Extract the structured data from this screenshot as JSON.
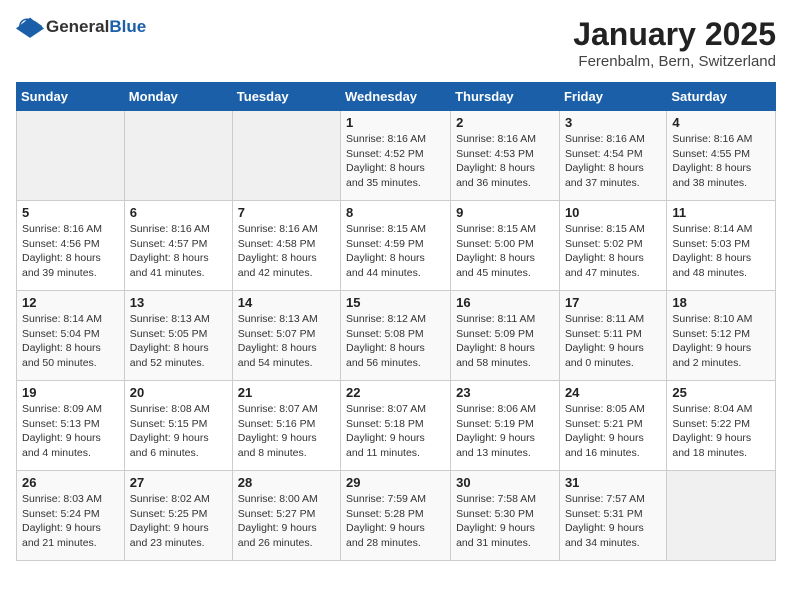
{
  "header": {
    "logo_general": "General",
    "logo_blue": "Blue",
    "title": "January 2025",
    "location": "Ferenbalm, Bern, Switzerland"
  },
  "weekdays": [
    "Sunday",
    "Monday",
    "Tuesday",
    "Wednesday",
    "Thursday",
    "Friday",
    "Saturday"
  ],
  "weeks": [
    [
      {
        "day": "",
        "content": ""
      },
      {
        "day": "",
        "content": ""
      },
      {
        "day": "",
        "content": ""
      },
      {
        "day": "1",
        "content": "Sunrise: 8:16 AM\nSunset: 4:52 PM\nDaylight: 8 hours\nand 35 minutes."
      },
      {
        "day": "2",
        "content": "Sunrise: 8:16 AM\nSunset: 4:53 PM\nDaylight: 8 hours\nand 36 minutes."
      },
      {
        "day": "3",
        "content": "Sunrise: 8:16 AM\nSunset: 4:54 PM\nDaylight: 8 hours\nand 37 minutes."
      },
      {
        "day": "4",
        "content": "Sunrise: 8:16 AM\nSunset: 4:55 PM\nDaylight: 8 hours\nand 38 minutes."
      }
    ],
    [
      {
        "day": "5",
        "content": "Sunrise: 8:16 AM\nSunset: 4:56 PM\nDaylight: 8 hours\nand 39 minutes."
      },
      {
        "day": "6",
        "content": "Sunrise: 8:16 AM\nSunset: 4:57 PM\nDaylight: 8 hours\nand 41 minutes."
      },
      {
        "day": "7",
        "content": "Sunrise: 8:16 AM\nSunset: 4:58 PM\nDaylight: 8 hours\nand 42 minutes."
      },
      {
        "day": "8",
        "content": "Sunrise: 8:15 AM\nSunset: 4:59 PM\nDaylight: 8 hours\nand 44 minutes."
      },
      {
        "day": "9",
        "content": "Sunrise: 8:15 AM\nSunset: 5:00 PM\nDaylight: 8 hours\nand 45 minutes."
      },
      {
        "day": "10",
        "content": "Sunrise: 8:15 AM\nSunset: 5:02 PM\nDaylight: 8 hours\nand 47 minutes."
      },
      {
        "day": "11",
        "content": "Sunrise: 8:14 AM\nSunset: 5:03 PM\nDaylight: 8 hours\nand 48 minutes."
      }
    ],
    [
      {
        "day": "12",
        "content": "Sunrise: 8:14 AM\nSunset: 5:04 PM\nDaylight: 8 hours\nand 50 minutes."
      },
      {
        "day": "13",
        "content": "Sunrise: 8:13 AM\nSunset: 5:05 PM\nDaylight: 8 hours\nand 52 minutes."
      },
      {
        "day": "14",
        "content": "Sunrise: 8:13 AM\nSunset: 5:07 PM\nDaylight: 8 hours\nand 54 minutes."
      },
      {
        "day": "15",
        "content": "Sunrise: 8:12 AM\nSunset: 5:08 PM\nDaylight: 8 hours\nand 56 minutes."
      },
      {
        "day": "16",
        "content": "Sunrise: 8:11 AM\nSunset: 5:09 PM\nDaylight: 8 hours\nand 58 minutes."
      },
      {
        "day": "17",
        "content": "Sunrise: 8:11 AM\nSunset: 5:11 PM\nDaylight: 9 hours\nand 0 minutes."
      },
      {
        "day": "18",
        "content": "Sunrise: 8:10 AM\nSunset: 5:12 PM\nDaylight: 9 hours\nand 2 minutes."
      }
    ],
    [
      {
        "day": "19",
        "content": "Sunrise: 8:09 AM\nSunset: 5:13 PM\nDaylight: 9 hours\nand 4 minutes."
      },
      {
        "day": "20",
        "content": "Sunrise: 8:08 AM\nSunset: 5:15 PM\nDaylight: 9 hours\nand 6 minutes."
      },
      {
        "day": "21",
        "content": "Sunrise: 8:07 AM\nSunset: 5:16 PM\nDaylight: 9 hours\nand 8 minutes."
      },
      {
        "day": "22",
        "content": "Sunrise: 8:07 AM\nSunset: 5:18 PM\nDaylight: 9 hours\nand 11 minutes."
      },
      {
        "day": "23",
        "content": "Sunrise: 8:06 AM\nSunset: 5:19 PM\nDaylight: 9 hours\nand 13 minutes."
      },
      {
        "day": "24",
        "content": "Sunrise: 8:05 AM\nSunset: 5:21 PM\nDaylight: 9 hours\nand 16 minutes."
      },
      {
        "day": "25",
        "content": "Sunrise: 8:04 AM\nSunset: 5:22 PM\nDaylight: 9 hours\nand 18 minutes."
      }
    ],
    [
      {
        "day": "26",
        "content": "Sunrise: 8:03 AM\nSunset: 5:24 PM\nDaylight: 9 hours\nand 21 minutes."
      },
      {
        "day": "27",
        "content": "Sunrise: 8:02 AM\nSunset: 5:25 PM\nDaylight: 9 hours\nand 23 minutes."
      },
      {
        "day": "28",
        "content": "Sunrise: 8:00 AM\nSunset: 5:27 PM\nDaylight: 9 hours\nand 26 minutes."
      },
      {
        "day": "29",
        "content": "Sunrise: 7:59 AM\nSunset: 5:28 PM\nDaylight: 9 hours\nand 28 minutes."
      },
      {
        "day": "30",
        "content": "Sunrise: 7:58 AM\nSunset: 5:30 PM\nDaylight: 9 hours\nand 31 minutes."
      },
      {
        "day": "31",
        "content": "Sunrise: 7:57 AM\nSunset: 5:31 PM\nDaylight: 9 hours\nand 34 minutes."
      },
      {
        "day": "",
        "content": ""
      }
    ]
  ]
}
